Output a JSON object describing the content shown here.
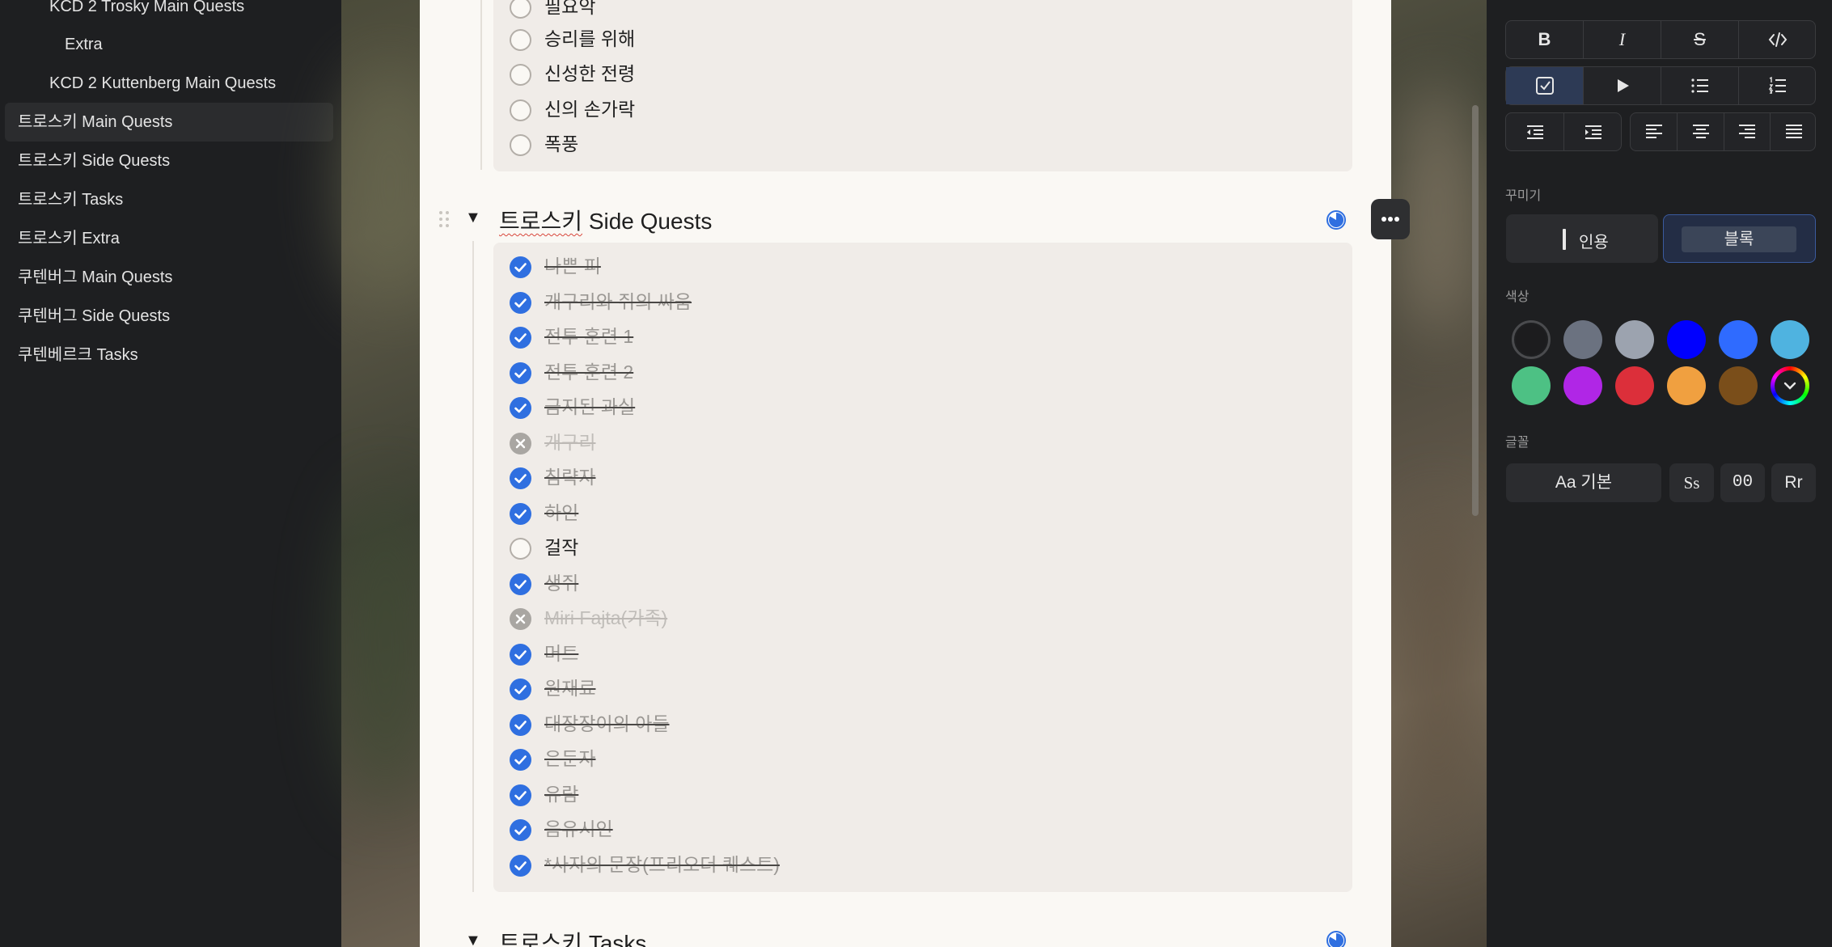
{
  "sidebar": {
    "items": [
      {
        "label": "KCD 2 Trosky Main Quests"
      },
      {
        "label": "Extra"
      },
      {
        "label": "KCD 2 Kuttenberg Main Quests"
      },
      {
        "label": "트로스키 Main Quests",
        "active": true
      },
      {
        "label": "트로스키 Side Quests"
      },
      {
        "label": "트로스키 Tasks"
      },
      {
        "label": "트로스키 Extra"
      },
      {
        "label": "쿠텐버그 Main Quests"
      },
      {
        "label": "쿠텐버그 Side Quests"
      },
      {
        "label": "쿠텐베르크 Tasks"
      }
    ]
  },
  "main": {
    "prev_list": [
      "필요악",
      "승리를 위해",
      "신성한 전령",
      "신의 손가락",
      "폭풍"
    ],
    "section": {
      "title_prefix": "트로스키",
      "title_rest": " Side Quests",
      "items": [
        {
          "label": "나쁜 피",
          "state": "done"
        },
        {
          "label": "개구리와 쥐의 싸움",
          "state": "done"
        },
        {
          "label": "전투 훈련 1",
          "state": "done"
        },
        {
          "label": "전투 훈련 2",
          "state": "done"
        },
        {
          "label": "금지된 과실",
          "state": "done"
        },
        {
          "label": "개구리",
          "state": "cancel"
        },
        {
          "label": "침략자",
          "state": "done"
        },
        {
          "label": "하인",
          "state": "done"
        },
        {
          "label": "걸작",
          "state": "empty"
        },
        {
          "label": "생쥐",
          "state": "done"
        },
        {
          "label": "Miri Fajta(가족)",
          "state": "cancel"
        },
        {
          "label": "머트",
          "state": "done"
        },
        {
          "label": "원재료",
          "state": "done"
        },
        {
          "label": "대장장이의 아들",
          "state": "done"
        },
        {
          "label": "은둔자",
          "state": "done"
        },
        {
          "label": "유람",
          "state": "done"
        },
        {
          "label": "음유시인",
          "state": "done"
        },
        {
          "label": "*사자의 문장(프리오더 퀘스트)",
          "state": "done"
        }
      ]
    },
    "next_section": {
      "title_prefix": "트로스키",
      "title_rest": " Tasks"
    }
  },
  "toolbar": {
    "row1": [
      "bold",
      "italic",
      "strikethrough",
      "code"
    ],
    "row2": [
      "checklist",
      "toggle-list",
      "bullet-list",
      "numbered-list"
    ],
    "decorate_label": "꾸미기",
    "quote_label": "인용",
    "block_label": "블록",
    "color_label": "색상",
    "colors": [
      "#1c1c1e",
      "#6b7280",
      "#9ca3af",
      "#0000ff",
      "#2f6bff",
      "#4fb3e0",
      "#4dc184",
      "#b026e6",
      "#dc2f3a",
      "#f0a040",
      "#7a4e1a"
    ],
    "font_label": "글꼴",
    "font_default": "Aa 기본",
    "font_serif": "Ss",
    "font_mono": "00",
    "font_round": "Rr",
    "bold_glyph": "B",
    "italic_glyph": "I",
    "strike_glyph": "S"
  }
}
